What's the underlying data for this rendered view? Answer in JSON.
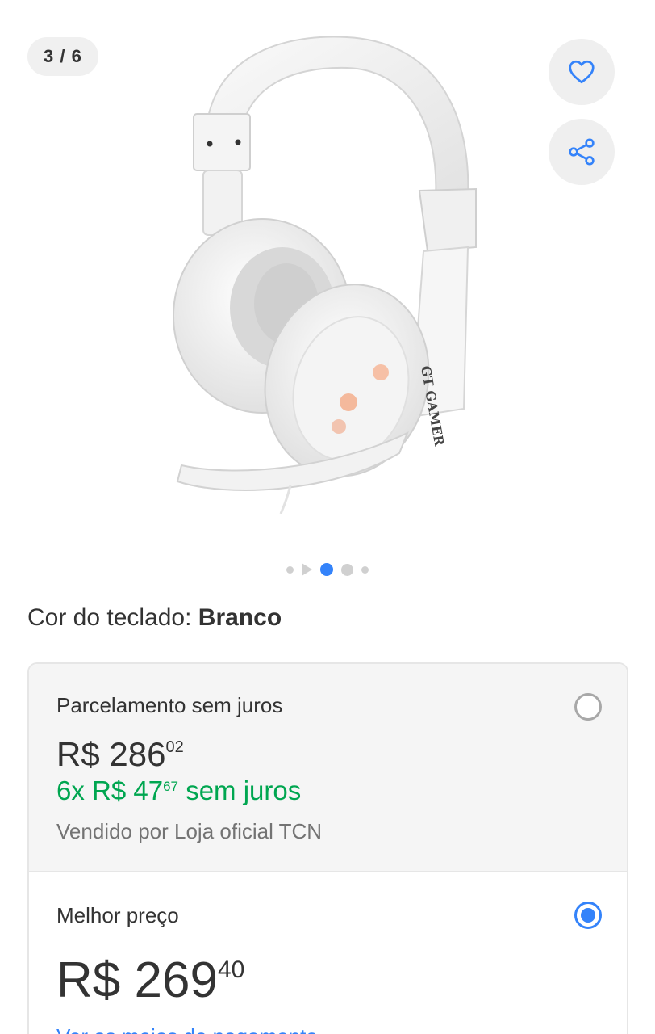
{
  "gallery": {
    "counter": "3 / 6",
    "favorite_icon": "heart-icon",
    "share_icon": "share-icon",
    "image_text": "GT GAMER",
    "slide_dots": 5,
    "active_dot": 3
  },
  "variation": {
    "label": "Cor do teclado:",
    "value": "Branco"
  },
  "offers": [
    {
      "title": "Parcelamento sem juros",
      "price_currency": "R$",
      "price_integer": "286",
      "price_cents": "02",
      "installments_prefix": "6x R$ 47",
      "installments_cents": "67",
      "installments_suffix": "sem juros",
      "seller": "Vendido por Loja oficial TCN",
      "selected": false
    },
    {
      "title": "Melhor preço",
      "price_currency": "R$",
      "price_integer": "269",
      "price_cents": "40",
      "payment_link": "Ver os meios de pagamento",
      "selected": true
    }
  ],
  "colors": {
    "accent": "#3483fa",
    "green": "#00a650",
    "text": "#333333",
    "muted": "#737373"
  }
}
